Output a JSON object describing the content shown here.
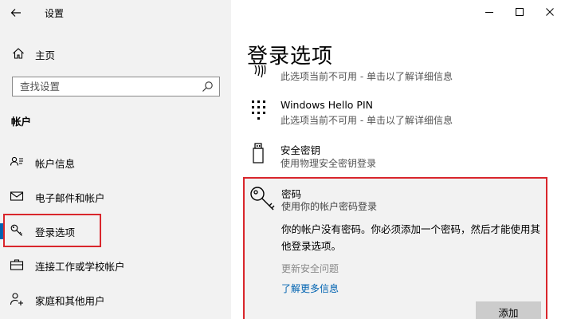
{
  "window": {
    "title": "设置"
  },
  "sidebar": {
    "home_label": "主页",
    "search_placeholder": "查找设置",
    "section_title": "帐户",
    "items": [
      {
        "label": "帐户信息",
        "icon": "account-info-icon"
      },
      {
        "label": "电子邮件和帐户",
        "icon": "mail-icon"
      },
      {
        "label": "登录选项",
        "icon": "key-icon",
        "active": true
      },
      {
        "label": "连接工作或学校帐户",
        "icon": "briefcase-icon"
      },
      {
        "label": "家庭和其他用户",
        "icon": "person-add-icon"
      }
    ]
  },
  "main": {
    "title": "登录选项",
    "options": [
      {
        "name": "fingerprint",
        "title": "",
        "subtitle": "此选项当前不可用 - 单击以了解详细信息",
        "icon": "fingerprint-icon"
      },
      {
        "name": "pin",
        "title": "Windows Hello PIN",
        "subtitle": "此选项当前不可用 - 单击以了解详细信息",
        "icon": "keypad-icon"
      },
      {
        "name": "security-key",
        "title": "安全密钥",
        "subtitle": "使用物理安全密钥登录",
        "icon": "usb-key-icon"
      }
    ],
    "password": {
      "title": "密码",
      "subtitle": "使用你的帐户密码登录",
      "message": "你的帐户没有密码。你必须添加一个密码，然后才能使用其他登录选项。",
      "disabled_link": "更新安全问题",
      "link": "了解更多信息",
      "button": "添加",
      "icon": "key-icon"
    }
  },
  "colors": {
    "sidebar_bg": "#f2f2f2",
    "accent": "#0063b1",
    "highlight": "#d9262c"
  }
}
